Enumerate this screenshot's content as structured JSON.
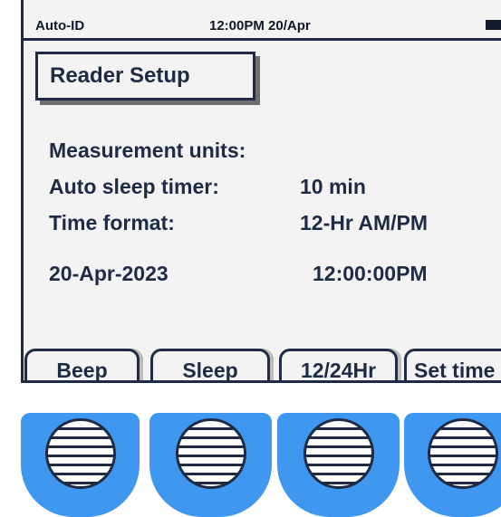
{
  "status_bar": {
    "left_label": "Auto-ID",
    "clock": "12:00PM 20/Apr",
    "battery_icon": "battery-full-icon"
  },
  "title": "Reader Setup",
  "settings": {
    "measurement_units_label": "Measurement units:",
    "measurement_units_value": "",
    "auto_sleep_label": "Auto sleep timer:",
    "auto_sleep_value": "10 min",
    "time_format_label": "Time format:",
    "time_format_value": "12-Hr AM/PM",
    "date": "20-Apr-2023",
    "time": "12:00:00PM"
  },
  "softkeys": [
    {
      "label": "Beep"
    },
    {
      "label": "Sleep"
    },
    {
      "label": "12/24Hr"
    },
    {
      "label": "Set time"
    }
  ],
  "hardkeys": [
    {
      "icon": "speaker-grille-icon"
    },
    {
      "icon": "speaker-grille-icon"
    },
    {
      "icon": "speaker-grille-icon"
    },
    {
      "icon": "speaker-grille-icon"
    }
  ],
  "colors": {
    "screen_background": "#f3f3f3",
    "text": "#1f2a44",
    "hardkey": "#3f97f0"
  }
}
